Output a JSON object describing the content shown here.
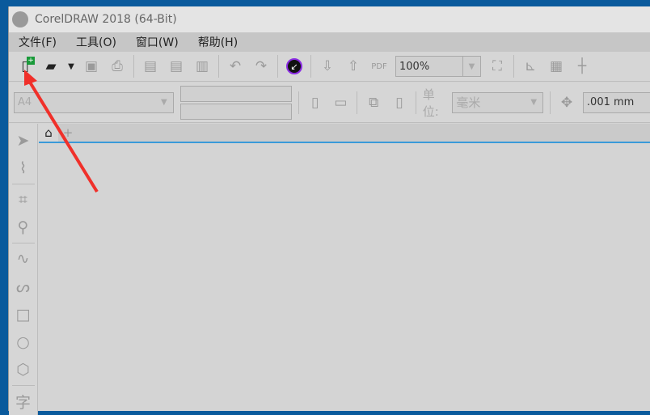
{
  "window": {
    "title": "CorelDRAW 2018 (64-Bit)"
  },
  "menu": [
    {
      "label": "文件(F)"
    },
    {
      "label": "工具(O)"
    },
    {
      "label": "窗口(W)"
    },
    {
      "label": "帮助(H)"
    }
  ],
  "toolbar": {
    "zoom_value": "100%",
    "pdf_label": "PDF"
  },
  "property_bar": {
    "page_size": "A4",
    "unit_label": "单位:",
    "unit_value": "毫米",
    "nudge_value": ".001 mm"
  },
  "tabs": {
    "add": "+"
  },
  "toolbox": {
    "text_tool": "字"
  },
  "colors": {
    "accent": "#3a9ad9",
    "annotation_arrow": "#f0302a",
    "new_badge": "#1a9a3a"
  }
}
